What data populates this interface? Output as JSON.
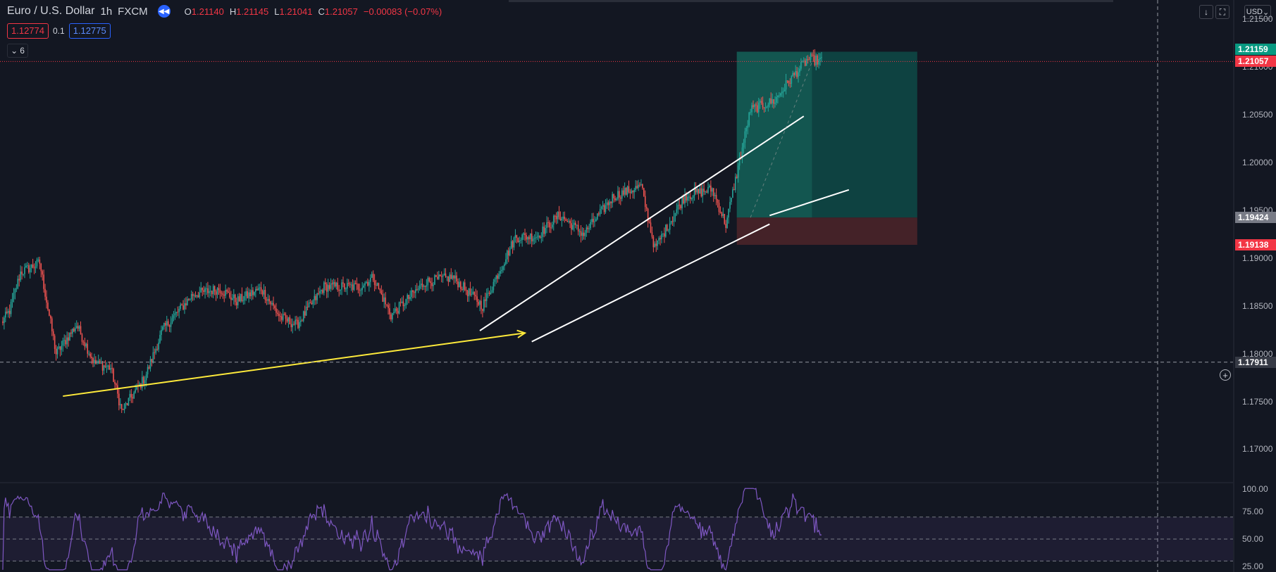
{
  "header": {
    "symbol": "Euro / U.S. Dollar",
    "interval": "1h",
    "exchange": "FXCM",
    "ohlc": {
      "o_label": "O",
      "o": "1.21140",
      "h_label": "H",
      "h": "1.21145",
      "l_label": "L",
      "l": "1.21041",
      "c_label": "C",
      "c": "1.21057",
      "change": "−0.00083 (−0.07%)"
    }
  },
  "trade": {
    "sell_price": "1.12774",
    "spread": "0.1",
    "buy_price": "1.12775"
  },
  "indicators_toggle": {
    "count": "6"
  },
  "toolbar": {
    "currency": "USD"
  },
  "price_axis": {
    "ticks": [
      "1.21500",
      "1.21000",
      "1.20500",
      "1.20000",
      "1.19500",
      "1.19000",
      "1.18500",
      "1.18000",
      "1.17500",
      "1.17000"
    ],
    "labels": {
      "target": "1.21159",
      "last": "1.21057",
      "entry": "1.19424",
      "stop": "1.19138",
      "crosshair": "1.17911"
    }
  },
  "rsi_axis": {
    "ticks": [
      "100.00",
      "75.00",
      "50.00",
      "25.00"
    ]
  },
  "colors": {
    "background": "#131722",
    "up": "#26a69a",
    "down": "#ef5350",
    "rsi": "#7e57c2",
    "arrow": "#ffeb3b",
    "target_zone": "#0e4a47",
    "stop_zone": "#4a2329",
    "last_price": "#f23645",
    "target_label": "#089981"
  },
  "chart_data": {
    "type": "candlestick",
    "symbol": "EURUSD",
    "interval": "1h",
    "ylim": [
      1.1665,
      1.217
    ],
    "last_price": 1.21057,
    "anchors": [
      [
        0,
        1.1832
      ],
      [
        6,
        1.1845
      ],
      [
        14,
        1.1885
      ],
      [
        28,
        1.1895
      ],
      [
        40,
        1.18
      ],
      [
        55,
        1.183
      ],
      [
        68,
        1.179
      ],
      [
        80,
        1.1785
      ],
      [
        88,
        1.174
      ],
      [
        105,
        1.1775
      ],
      [
        118,
        1.1825
      ],
      [
        140,
        1.1862
      ],
      [
        160,
        1.1868
      ],
      [
        172,
        1.1855
      ],
      [
        190,
        1.1868
      ],
      [
        204,
        1.1838
      ],
      [
        216,
        1.183
      ],
      [
        236,
        1.187
      ],
      [
        262,
        1.187
      ],
      [
        272,
        1.188
      ],
      [
        285,
        1.184
      ],
      [
        310,
        1.1875
      ],
      [
        330,
        1.188
      ],
      [
        352,
        1.185
      ],
      [
        376,
        1.1922
      ],
      [
        392,
        1.1923
      ],
      [
        408,
        1.1945
      ],
      [
        426,
        1.1925
      ],
      [
        448,
        1.1965
      ],
      [
        468,
        1.1975
      ],
      [
        478,
        1.191
      ],
      [
        500,
        1.1965
      ],
      [
        520,
        1.1972
      ],
      [
        530,
        1.1935
      ],
      [
        548,
        1.2055
      ],
      [
        566,
        1.2065
      ],
      [
        576,
        1.2085
      ],
      [
        590,
        1.2108
      ],
      [
        600,
        1.2106
      ]
    ],
    "trend_lines": [
      {
        "from": [
          350,
          1.1824
        ],
        "to": [
          587,
          1.20484
        ]
      },
      {
        "from": [
          388,
          1.18125
        ],
        "to": [
          562,
          1.19355
        ]
      },
      {
        "from": [
          562,
          1.19445
        ],
        "to": [
          620,
          1.19714
        ]
      }
    ],
    "arrow": {
      "from": [
        45,
        1.17555
      ],
      "to": [
        383,
        1.18216
      ]
    },
    "position": {
      "type": "long",
      "entry": 1.19424,
      "target": 1.21159,
      "stop": 1.19138
    },
    "rsi": {
      "ylim": [
        20,
        100
      ],
      "levels": [
        70,
        50,
        30
      ]
    }
  }
}
